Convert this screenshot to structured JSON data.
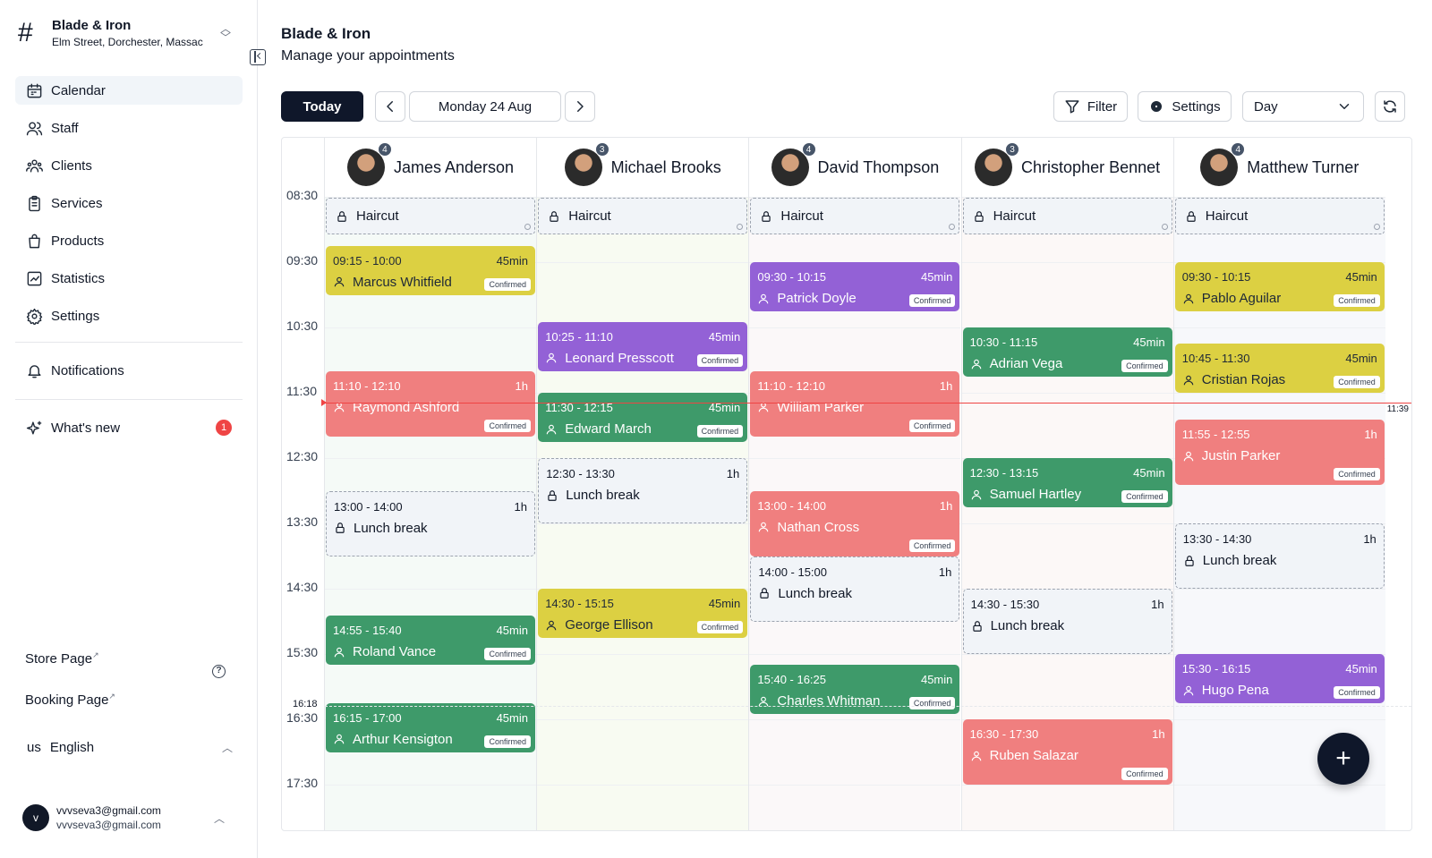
{
  "store": {
    "name": "Blade & Iron",
    "address": "Elm Street, Dorchester, Massac"
  },
  "nav": [
    {
      "label": "Calendar",
      "icon": "calendar-icon",
      "active": true
    },
    {
      "label": "Staff",
      "icon": "users-icon"
    },
    {
      "label": "Clients",
      "icon": "clients-icon"
    },
    {
      "label": "Services",
      "icon": "clipboard-icon"
    },
    {
      "label": "Products",
      "icon": "shopping-bag-icon"
    },
    {
      "label": "Statistics",
      "icon": "chart-icon"
    },
    {
      "label": "Settings",
      "icon": "gear-icon"
    }
  ],
  "notifications": "Notifications",
  "whats_new": {
    "label": "What's new",
    "badge": "1"
  },
  "store_page": "Store Page",
  "booking_page": "Booking Page",
  "language": {
    "code": "us",
    "label": "English"
  },
  "user": {
    "initial": "v",
    "email": "vvvseva3@gmail.com",
    "sub": "vvvseva3@gmail.com"
  },
  "header": {
    "title": "Blade & Iron",
    "subtitle": "Manage your appointments"
  },
  "toolbar": {
    "today": "Today",
    "date": "Monday 24 Aug",
    "filter": "Filter",
    "settings": "Settings",
    "view": "Day"
  },
  "times": [
    "08:30",
    "09:30",
    "10:30",
    "11:30",
    "12:30",
    "13:30",
    "14:30",
    "15:30",
    "16:30",
    "17:30"
  ],
  "now": {
    "time": "11:39",
    "marker": "16:18"
  },
  "status_label": "Confirmed",
  "staff": [
    {
      "name": "James Anderson",
      "count": "4",
      "slot": "Haircut",
      "events": [
        {
          "start": "09:15",
          "end": "10:00",
          "duration": "45min",
          "client": "Marcus Whitfield",
          "color": "yellow"
        },
        {
          "start": "11:10",
          "end": "12:10",
          "duration": "1h",
          "client": "Raymond Ashford",
          "color": "red"
        },
        {
          "start": "13:00",
          "end": "14:00",
          "duration": "1h",
          "client": "Lunch break",
          "color": "break"
        },
        {
          "start": "14:55",
          "end": "15:40",
          "duration": "45min",
          "client": "Roland Vance",
          "color": "green"
        },
        {
          "start": "16:15",
          "end": "17:00",
          "duration": "45min",
          "client": "Arthur Kensigton",
          "color": "green"
        }
      ]
    },
    {
      "name": "Michael Brooks",
      "count": "3",
      "slot": "Haircut",
      "events": [
        {
          "start": "10:25",
          "end": "11:10",
          "duration": "45min",
          "client": "Leonard Presscott",
          "color": "purple"
        },
        {
          "start": "11:30",
          "end": "12:15",
          "duration": "45min",
          "client": "Edward March",
          "color": "green"
        },
        {
          "start": "12:30",
          "end": "13:30",
          "duration": "1h",
          "client": "Lunch break",
          "color": "break"
        },
        {
          "start": "14:30",
          "end": "15:15",
          "duration": "45min",
          "client": "George Ellison",
          "color": "yellow"
        }
      ]
    },
    {
      "name": "David Thompson",
      "count": "4",
      "slot": "Haircut",
      "events": [
        {
          "start": "09:30",
          "end": "10:15",
          "duration": "45min",
          "client": "Patrick Doyle",
          "color": "purple"
        },
        {
          "start": "11:10",
          "end": "12:10",
          "duration": "1h",
          "client": "William Parker",
          "color": "red"
        },
        {
          "start": "13:00",
          "end": "14:00",
          "duration": "1h",
          "client": "Nathan Cross",
          "color": "red"
        },
        {
          "start": "14:00",
          "end": "15:00",
          "duration": "1h",
          "client": "Lunch break",
          "color": "break"
        },
        {
          "start": "15:40",
          "end": "16:25",
          "duration": "45min",
          "client": "Charles Whitman",
          "color": "green"
        }
      ]
    },
    {
      "name": "Christopher Bennet",
      "count": "3",
      "slot": "Haircut",
      "events": [
        {
          "start": "10:30",
          "end": "11:15",
          "duration": "45min",
          "client": "Adrian Vega",
          "color": "green"
        },
        {
          "start": "12:30",
          "end": "13:15",
          "duration": "45min",
          "client": "Samuel Hartley",
          "color": "green"
        },
        {
          "start": "14:30",
          "end": "15:30",
          "duration": "1h",
          "client": "Lunch break",
          "color": "break"
        },
        {
          "start": "16:30",
          "end": "17:30",
          "duration": "1h",
          "client": "Ruben Salazar",
          "color": "red"
        }
      ]
    },
    {
      "name": "Matthew Turner",
      "count": "4",
      "slot": "Haircut",
      "events": [
        {
          "start": "09:30",
          "end": "10:15",
          "duration": "45min",
          "client": "Pablo Aguilar",
          "color": "yellow"
        },
        {
          "start": "10:45",
          "end": "11:30",
          "duration": "45min",
          "client": "Cristian Rojas",
          "color": "yellow"
        },
        {
          "start": "11:55",
          "end": "12:55",
          "duration": "1h",
          "client": "Justin Parker",
          "color": "red"
        },
        {
          "start": "13:30",
          "end": "14:30",
          "duration": "1h",
          "client": "Lunch break",
          "color": "break"
        },
        {
          "start": "15:30",
          "end": "16:15",
          "duration": "45min",
          "client": "Hugo Pena",
          "color": "purple"
        }
      ]
    }
  ],
  "colors": {
    "yellow": "#dcd042",
    "purple": "#9361d6",
    "green": "#3e9a6a",
    "red": "#f07f7f",
    "accent": "#0f172a"
  }
}
